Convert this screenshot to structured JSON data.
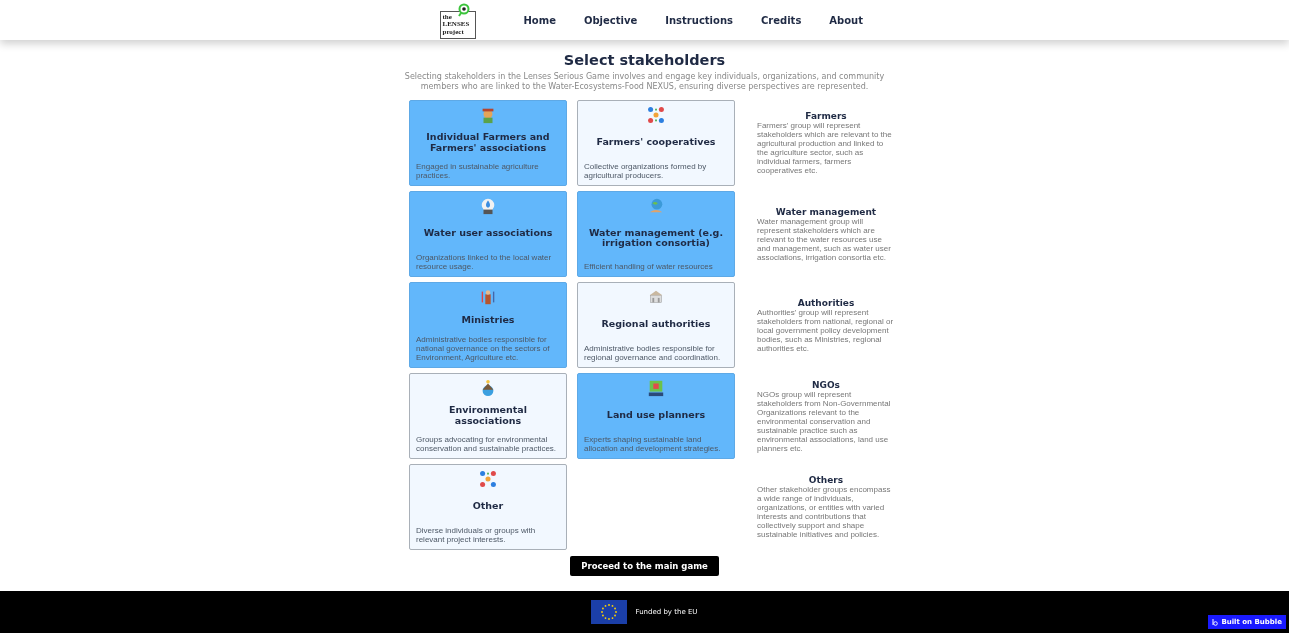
{
  "header": {
    "logo": [
      "the",
      "LENSES",
      "project"
    ],
    "nav": [
      {
        "label": "Home"
      },
      {
        "label": "Objective"
      },
      {
        "label": "Instructions"
      },
      {
        "label": "Credits"
      },
      {
        "label": "About"
      }
    ]
  },
  "title": "Select stakeholders",
  "intro": "Selecting stakeholders in the Lenses Serious Game involves and engage key individuals, organizations, and community members who are linked to the Water-Ecosystems-Food NEXUS, ensuring diverse perspectives are represented.",
  "rows": [
    {
      "cards": [
        {
          "title": "Individual Farmers and Farmers' associations",
          "text": "Engaged in sustainable agriculture practices.",
          "selected": true
        },
        {
          "title": "Farmers' cooperatives",
          "text": "Collective organizations formed by agricultural producers.",
          "selected": false
        }
      ],
      "group": {
        "title": "Farmers",
        "text": "Farmers' group will represent stakeholders which are relevant to the agricultural production and linked to the agriculture sector, such as individual farmers, farmers cooperatives etc."
      }
    },
    {
      "cards": [
        {
          "title": "Water user associations",
          "text": "Organizations linked to the local water resource usage.",
          "selected": true
        },
        {
          "title": "Water management (e.g. irrigation consortia)",
          "text": "Efficient handling of water resources",
          "selected": true
        }
      ],
      "group": {
        "title": "Water management",
        "text": "Water management group will represent stakeholders which are relevant to the water resources use and management, such as water user associations, irrigation consortia etc."
      }
    },
    {
      "cards": [
        {
          "title": "Ministries",
          "text": "Administrative bodies responsible for national governance on the sectors of Environment, Agriculture etc.",
          "selected": true
        },
        {
          "title": "Regional authorities",
          "text": "Administrative bodies responsible for regional governance and coordination.",
          "selected": false
        }
      ],
      "group": {
        "title": "Authorities",
        "text": "Authorities' group will represent stakeholders from national, regional or local government policy development bodies, such as Ministries, regional authorities etc."
      }
    },
    {
      "cards": [
        {
          "title": "Environmental associations",
          "text": "Groups advocating for environmental conservation and sustainable practices.",
          "selected": false
        },
        {
          "title": "Land use planners",
          "text": "Experts shaping sustainable land allocation and development strategies.",
          "selected": true
        }
      ],
      "group": {
        "title": "NGOs",
        "text": "NGOs group will represent stakeholders from Non-Governmental Organizations relevant to the environmental conservation and sustainable practice such as environmental associations, land use planners etc."
      }
    },
    {
      "cards": [
        {
          "title": "Other",
          "text": "Diverse individuals or groups with relevant project interests.",
          "selected": false
        }
      ],
      "group": {
        "title": "Others",
        "text": "Other stakeholder groups encompass a wide range of individuals, organizations, or entities with varied interests and contributions that collectively support and shape sustainable initiatives and policies."
      }
    }
  ],
  "proceed": "Proceed to the main game",
  "footer": {
    "funded": "Funded by the EU",
    "badge": "Built on Bubble"
  }
}
